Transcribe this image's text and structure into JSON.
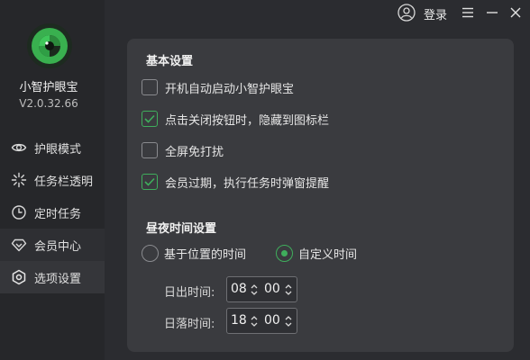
{
  "app": {
    "name": "小智护眼宝",
    "version": "V2.0.32.66"
  },
  "topbar": {
    "login_label": "登录"
  },
  "nav": [
    {
      "label": "护眼模式",
      "icon": "eye-icon"
    },
    {
      "label": "任务栏透明",
      "icon": "sparkle-icon"
    },
    {
      "label": "定时任务",
      "icon": "clock-icon"
    },
    {
      "label": "会员中心",
      "icon": "diamond-icon"
    },
    {
      "label": "选项设置",
      "icon": "settings-icon"
    }
  ],
  "basic": {
    "title": "基本设置",
    "options": [
      {
        "label": "开机自动启动小智护眼宝",
        "checked": false
      },
      {
        "label": "点击关闭按钮时，隐藏到图标栏",
        "checked": true
      },
      {
        "label": "全屏免打扰",
        "checked": false
      },
      {
        "label": "会员过期，执行任务时弹窗提醒",
        "checked": true
      }
    ]
  },
  "daynight": {
    "title": "昼夜时间设置",
    "radio_location": "基于位置的时间",
    "radio_custom": "自定义时间",
    "selected": "custom",
    "sunrise_label": "日出时间:",
    "sunrise_hour": "08",
    "sunrise_min": "00",
    "sunset_label": "日落时间:",
    "sunset_hour": "18",
    "sunset_min": "00"
  },
  "colors": {
    "accent": "#3fae5c",
    "bg": "#2b2c30",
    "sidebar": "#26272a",
    "card": "#3a3b3f"
  }
}
